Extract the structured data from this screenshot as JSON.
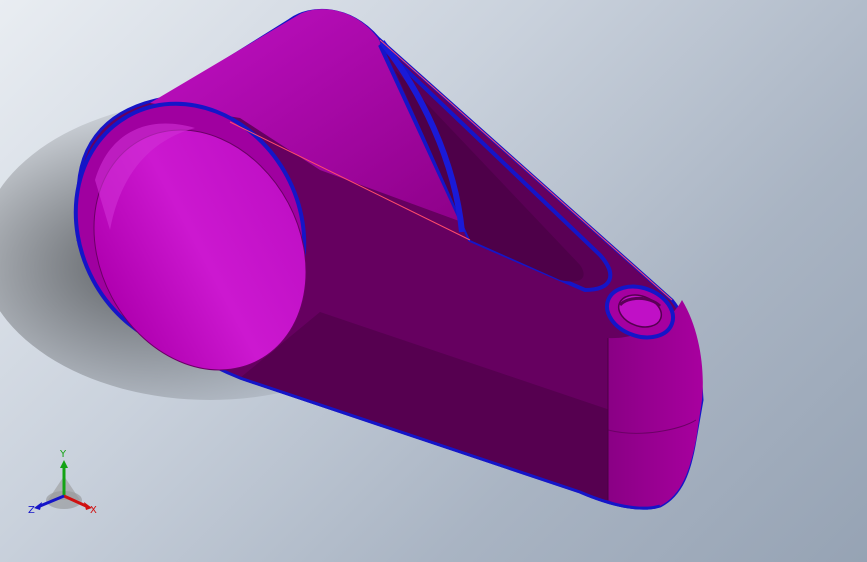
{
  "viewport": {
    "background_top": "#e9edf2",
    "background_bottom": "#96a3b4"
  },
  "model": {
    "part": "clamp-bracket",
    "colors": {
      "face_light": "#c815cc",
      "face_mid": "#a4009f",
      "face_dark": "#6a0063",
      "face_darkest": "#560050",
      "edge": "#1515c8",
      "highlight": "#ff4b6b"
    }
  },
  "triad": {
    "y_label": "Y",
    "x_label": "X",
    "z_label": "Z",
    "colors": {
      "x": "#d01010",
      "y": "#14a314",
      "z": "#1414c8"
    }
  }
}
